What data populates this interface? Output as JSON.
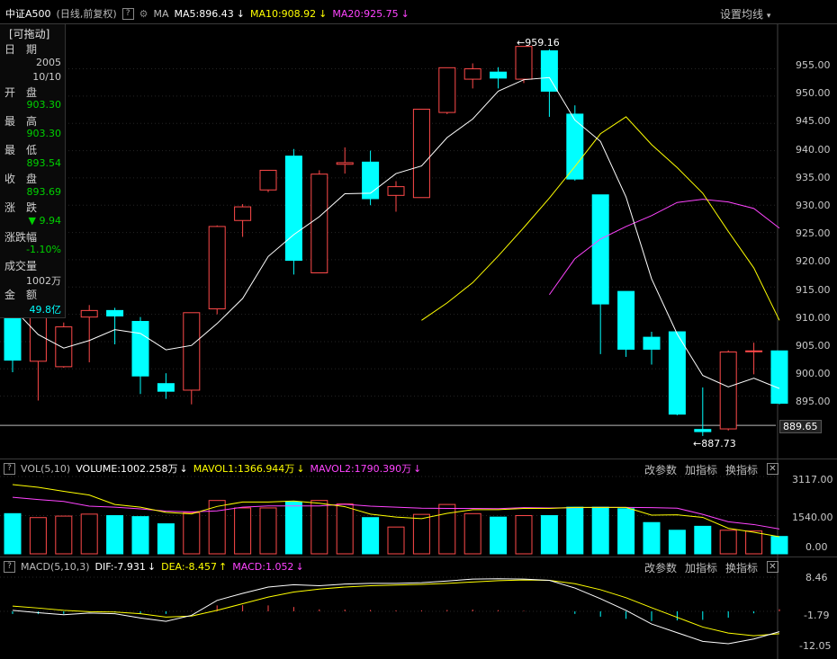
{
  "header": {
    "title": "中证A500",
    "sub": "(日线,前复权)",
    "help": "?",
    "ma_label": "MA",
    "ma5": "MA5:896.43",
    "ma10": "MA10:908.92",
    "ma20": "MA20:925.75",
    "arrow_down": "↓",
    "settings": "设置均线",
    "settings_caret": "▾"
  },
  "info": {
    "tag": "[可拖动]",
    "date_label": "日　期",
    "year": "2005",
    "date": "10/10",
    "open_label": "开　盘",
    "open": "903.30",
    "high_label": "最　高",
    "high": "903.30",
    "low_label": "最　低",
    "low": "893.54",
    "close_label": "收　盘",
    "close": "893.69",
    "change_label": "涨　跌",
    "change": "▼ 9.94",
    "pct_label": "涨跌幅",
    "pct": "-1.10%",
    "vol_label": "成交量",
    "vol": "1002万",
    "amt_label": "金　额",
    "amt": "49.8亿"
  },
  "price_axis": [
    "955.00",
    "950.00",
    "945.00",
    "940.00",
    "935.00",
    "930.00",
    "925.00",
    "920.00",
    "915.00",
    "910.00",
    "905.00",
    "900.00",
    "895.00",
    "889.65"
  ],
  "annotations": {
    "high": "959.16",
    "low": "887.73"
  },
  "volume": {
    "label": "VOL(5,10)",
    "v": "VOLUME:1002.258万",
    "m1": "MAVOL1:1366.944万",
    "m2": "MAVOL2:1790.390万",
    "up": "↑",
    "down": "↓",
    "axis": [
      "3117.00",
      "1540.00",
      "0.00"
    ]
  },
  "macd": {
    "label": "MACD(5,10,3)",
    "dif": "DIF:-7.931",
    "dea": "DEA:-8.457",
    "m": "MACD:1.052",
    "up": "↑",
    "down": "↓",
    "axis": [
      "8.46",
      "-1.79",
      "-12.05"
    ]
  },
  "buttons": {
    "params": "改参数",
    "add": "加指标",
    "switch": "换指标",
    "close": "✕"
  },
  "colors": {
    "up": "#ff4a4a",
    "down": "#00ffff",
    "ma5": "#ffffff",
    "ma10": "#ffff00",
    "ma20": "#ff44ff",
    "green": "#00d200"
  },
  "chart_data": {
    "type": "candlestick",
    "candles": [
      {
        "o": 909.5,
        "c": 901.6,
        "h": 911.5,
        "l": 899.4
      },
      {
        "o": 901.4,
        "c": 910.2,
        "h": 912.5,
        "l": 894.2
      },
      {
        "o": 900.4,
        "c": 907.7,
        "h": 908.5,
        "l": 900.2
      },
      {
        "o": 909.5,
        "c": 910.7,
        "h": 911.7,
        "l": 901.2
      },
      {
        "o": 910.7,
        "c": 909.7,
        "h": 911.2,
        "l": 904.5
      },
      {
        "o": 908.7,
        "c": 898.7,
        "h": 909.5,
        "l": 895.4
      },
      {
        "o": 897.3,
        "c": 895.9,
        "h": 899.2,
        "l": 894.5
      },
      {
        "o": 896.1,
        "c": 910.3,
        "h": 910.3,
        "l": 893.5
      },
      {
        "o": 911.0,
        "c": 926.1,
        "h": 926.3,
        "l": 910.0
      },
      {
        "o": 927.2,
        "c": 929.7,
        "h": 930.2,
        "l": 924.2
      },
      {
        "o": 932.8,
        "c": 936.4,
        "h": 936.4,
        "l": 932.4
      },
      {
        "o": 939.0,
        "c": 919.9,
        "h": 940.3,
        "l": 917.3
      },
      {
        "o": 917.6,
        "c": 935.7,
        "h": 936.4,
        "l": 917.6
      },
      {
        "o": 937.5,
        "c": 937.8,
        "h": 940.6,
        "l": 935.8
      },
      {
        "o": 937.9,
        "c": 931.2,
        "h": 940.0,
        "l": 930.0
      },
      {
        "o": 931.8,
        "c": 933.4,
        "h": 934.4,
        "l": 928.8
      },
      {
        "o": 931.4,
        "c": 947.6,
        "h": 947.6,
        "l": 931.4
      },
      {
        "o": 947.0,
        "c": 955.2,
        "h": 955.2,
        "l": 946.7
      },
      {
        "o": 953.1,
        "c": 955.0,
        "h": 956.0,
        "l": 951.4
      },
      {
        "o": 954.4,
        "c": 953.3,
        "h": 955.3,
        "l": 951.4
      },
      {
        "o": 953.1,
        "c": 959.1,
        "h": 959.1,
        "l": 952.4
      },
      {
        "o": 958.3,
        "c": 950.9,
        "h": 958.6,
        "l": 946.2
      },
      {
        "o": 946.7,
        "c": 934.8,
        "h": 948.3,
        "l": 934.5
      },
      {
        "o": 931.9,
        "c": 911.9,
        "h": 931.9,
        "l": 902.7
      },
      {
        "o": 914.2,
        "c": 903.6,
        "h": 914.2,
        "l": 902.2
      },
      {
        "o": 905.8,
        "c": 903.6,
        "h": 906.8,
        "l": 900.8
      },
      {
        "o": 906.8,
        "c": 891.7,
        "h": 906.8,
        "l": 891.5
      },
      {
        "o": 888.9,
        "c": 888.5,
        "h": 896.6,
        "l": 887.7
      },
      {
        "o": 889.0,
        "c": 903.1,
        "h": 903.4,
        "l": 888.7
      },
      {
        "o": 903.3,
        "c": 903.3,
        "h": 904.8,
        "l": 899.0
      },
      {
        "o": 903.3,
        "c": 893.7,
        "h": 903.3,
        "l": 893.5
      }
    ],
    "ma5": [
      911.2,
      906.3,
      903.8,
      905.2,
      907.2,
      906.5,
      903.5,
      904.3,
      908.3,
      912.9,
      920.6,
      924.6,
      927.9,
      932.1,
      932.2,
      935.8,
      937.2,
      942.4,
      945.8,
      950.9,
      953.0,
      953.4,
      945.6,
      941.7,
      931.5,
      916.5,
      906.4,
      898.8,
      896.7,
      898.3,
      896.4
    ],
    "ma10": [
      null,
      null,
      null,
      null,
      null,
      null,
      null,
      null,
      null,
      null,
      null,
      null,
      null,
      null,
      null,
      null,
      908.9,
      912.1,
      915.8,
      920.7,
      925.9,
      931.3,
      937.1,
      943.1,
      946.2,
      941.1,
      936.9,
      932.2,
      925.2,
      918.5,
      908.9
    ],
    "ma20": [
      null,
      null,
      null,
      null,
      null,
      null,
      null,
      null,
      null,
      null,
      null,
      null,
      null,
      null,
      null,
      null,
      null,
      null,
      null,
      null,
      null,
      913.6,
      920.2,
      923.8,
      926.1,
      928.1,
      930.5,
      931.1,
      930.6,
      929.4,
      925.8
    ],
    "volume": [
      1620,
      1460,
      1520,
      1600,
      1540,
      1500,
      1210,
      1660,
      2150,
      1850,
      1850,
      2090,
      2150,
      2010,
      1460,
      1080,
      1590,
      1990,
      1620,
      1480,
      1540,
      1540,
      1880,
      1880,
      1820,
      1260,
      950,
      1110,
      950,
      920,
      700
    ],
    "mavol1": [
      2790,
      2680,
      2520,
      2370,
      1990,
      1880,
      1670,
      1610,
      1910,
      2090,
      2090,
      2130,
      2040,
      1900,
      1600,
      1480,
      1420,
      1630,
      1780,
      1780,
      1830,
      1830,
      1870,
      1870,
      1870,
      1560,
      1570,
      1470,
      1030,
      870,
      690
    ],
    "mavol2": [
      2280,
      2190,
      2110,
      1920,
      1880,
      1810,
      1720,
      1690,
      1730,
      1880,
      1930,
      1930,
      1930,
      2000,
      1920,
      1880,
      1840,
      1830,
      1830,
      1820,
      1860,
      1850,
      1860,
      1870,
      1870,
      1860,
      1840,
      1590,
      1290,
      1180,
      1000
    ],
    "dif": [
      -1.5,
      -2.2,
      -2.8,
      -2.3,
      -2.5,
      -3.8,
      -4.8,
      -3.0,
      1.5,
      3.6,
      5.5,
      6.2,
      5.9,
      6.4,
      6.6,
      6.6,
      6.8,
      7.3,
      7.9,
      8.0,
      7.9,
      7.5,
      5.2,
      2.0,
      -1.5,
      -5.6,
      -8.2,
      -10.8,
      -11.5,
      -10.1,
      -7.9
    ],
    "dea": [
      -0.2,
      -0.8,
      -1.5,
      -1.9,
      -2.0,
      -2.5,
      -3.5,
      -3.2,
      -1.5,
      0.5,
      2.5,
      4.0,
      4.9,
      5.5,
      5.9,
      6.1,
      6.3,
      6.6,
      7.0,
      7.4,
      7.6,
      7.5,
      6.5,
      4.7,
      2.3,
      -0.7,
      -3.6,
      -6.5,
      -8.3,
      -9.1,
      -8.5
    ],
    "macd_hist": [
      -1.3,
      -1.4,
      -1.3,
      -0.4,
      -0.5,
      -1.3,
      -1.3,
      0.2,
      3.0,
      3.1,
      3.0,
      2.2,
      1.0,
      0.9,
      0.7,
      0.5,
      0.5,
      0.7,
      0.9,
      0.6,
      0.3,
      0.0,
      -1.3,
      -2.7,
      -3.8,
      -4.9,
      -4.6,
      -4.3,
      -3.2,
      -1.0,
      1.05
    ],
    "price_range": [
      883.9,
      963.0
    ],
    "volume_range": [
      0,
      3117
    ],
    "macd_range": [
      -12.05,
      8.46
    ]
  }
}
